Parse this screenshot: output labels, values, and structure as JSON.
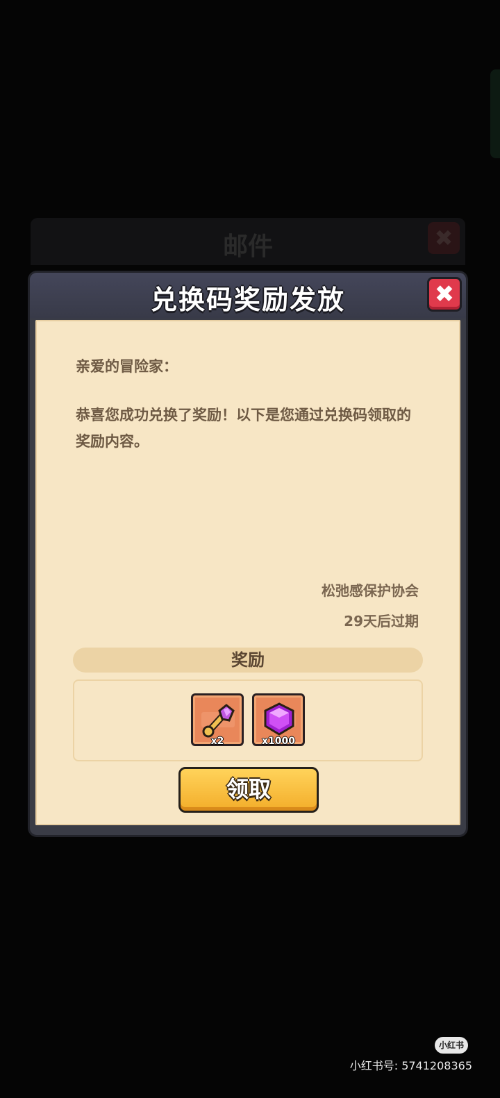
{
  "background": {
    "mail_title": "邮件",
    "mail_close_label": "✖"
  },
  "dialog": {
    "title": "兑换码奖励发放",
    "close_label": "✖",
    "greeting": "亲爱的冒险家：",
    "body": "恭喜您成功兑换了奖励！以下是您通过兑换码领取的奖励内容。",
    "signature": "松弛感保护协会",
    "expiry": "29天后过期",
    "reward_header": "奖励",
    "rewards": [
      {
        "icon": "key-icon",
        "qty": "x2"
      },
      {
        "icon": "gem-icon",
        "qty": "x1000"
      }
    ],
    "claim_label": "领取"
  },
  "watermark": {
    "logo": "小红书",
    "id": "小红书号: 5741208365"
  },
  "colors": {
    "paper": "#f7e6c5",
    "close_red": "#e03a4c",
    "claim_yellow": "#f3ad2a",
    "item_orange": "#e9875a"
  }
}
